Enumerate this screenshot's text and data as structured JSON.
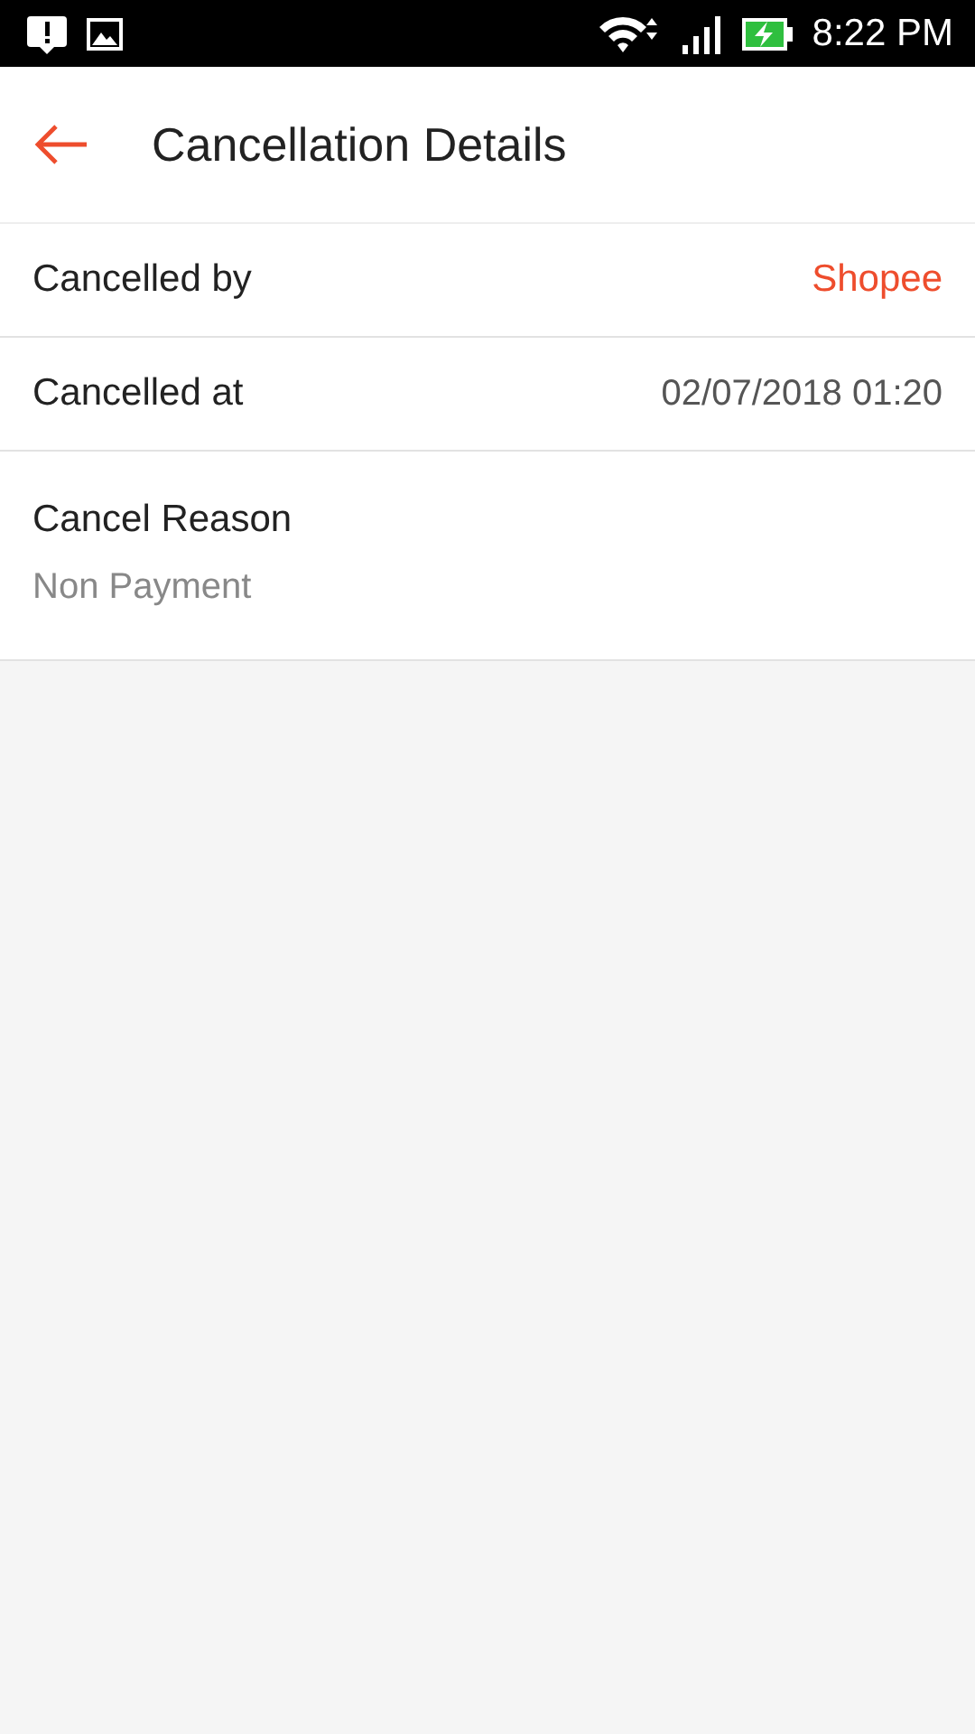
{
  "status_bar": {
    "time": "8:22 PM"
  },
  "header": {
    "title": "Cancellation Details"
  },
  "rows": [
    {
      "label": "Cancelled by",
      "value": "Shopee",
      "kind": "link"
    },
    {
      "label": "Cancelled at",
      "value": "02/07/2018 01:20",
      "kind": "plain"
    }
  ],
  "reason": {
    "label": "Cancel Reason",
    "value": "Non Payment"
  }
}
